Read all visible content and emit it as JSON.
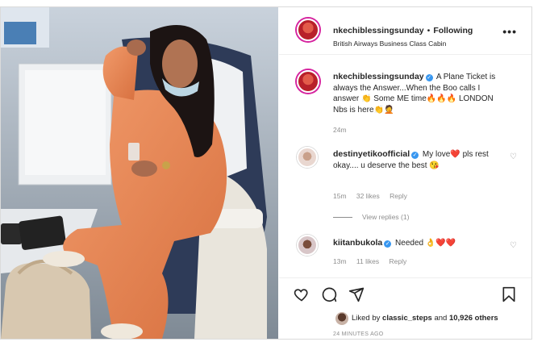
{
  "post": {
    "author": "nkechiblessingsunday",
    "follow_label": "Following",
    "location": "British Airways Business Class Cabin",
    "more_label": "•••",
    "caption": {
      "user": "nkechiblessingsunday",
      "text": "A Plane Ticket is always the Answer...When the Boo calls I answer 👏 Some ME time🔥🔥🔥 LONDON Nbs is here👏🤦",
      "age": "24m"
    },
    "comments": [
      {
        "user": "destinyetikoofficial",
        "text": "My love❤️ pls rest okay.... u deserve the best 😘",
        "age": "15m",
        "likes": "32 likes",
        "reply": "Reply",
        "view_replies": "View replies (1)"
      },
      {
        "user": "kiitanbukola",
        "text": "Needed 👌❤️❤️",
        "age": "13m",
        "likes": "11 likes",
        "reply": "Reply"
      }
    ],
    "liked_by_prefix": "Liked by",
    "liked_by_user": "classic_steps",
    "liked_by_suffix": "and",
    "likes_count": "10,926 others",
    "posted_time": "24 MINUTES AGO"
  },
  "colors": {
    "blue_verified": "#3897f0",
    "muted_text": "#8e8e8e",
    "story_ring": "#d6249f"
  },
  "icons": {
    "like": "heart-icon",
    "comment": "comment-icon",
    "share": "share-icon",
    "save": "bookmark-icon"
  }
}
